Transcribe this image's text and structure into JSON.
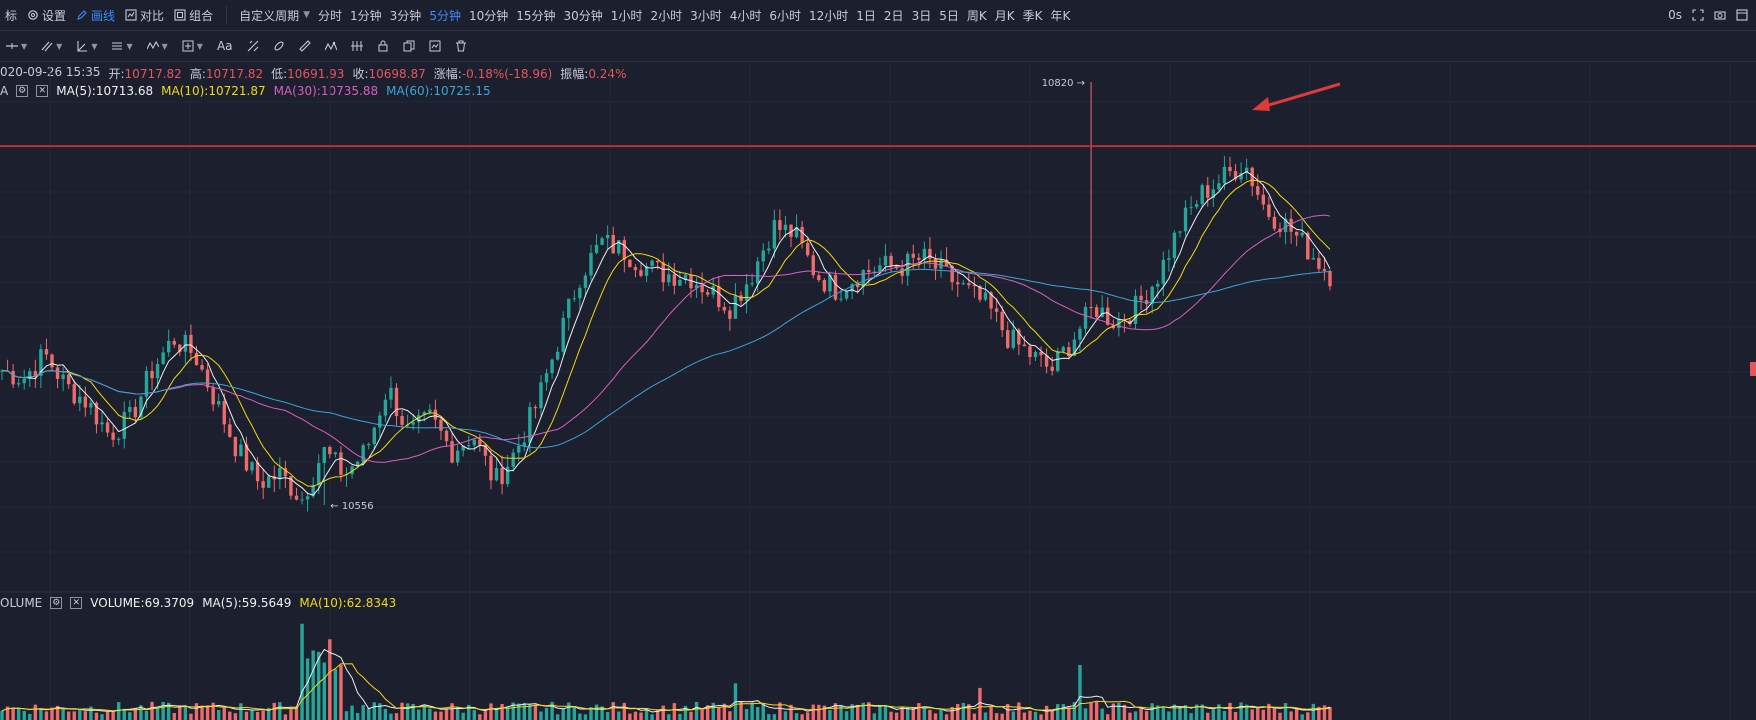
{
  "toolbar": {
    "items": [
      {
        "label": "标",
        "icon": "indicator-icon"
      },
      {
        "label": "设置",
        "icon": "gear-icon"
      },
      {
        "label": "画线",
        "icon": "pen-icon",
        "active": true
      },
      {
        "label": "对比",
        "icon": "compare-icon"
      },
      {
        "label": "组合",
        "icon": "layout-icon"
      }
    ],
    "custom_period": "自定义周期",
    "periods": [
      "分时",
      "1分钟",
      "3分钟",
      "5分钟",
      "10分钟",
      "15分钟",
      "30分钟",
      "1小时",
      "2小时",
      "3小时",
      "4小时",
      "6小时",
      "12小时",
      "1日",
      "2日",
      "3日",
      "5日",
      "周K",
      "月K",
      "季K",
      "年K"
    ],
    "active_period": "5分钟",
    "countdown": "0s"
  },
  "drawing_tools": [
    "line-tool-icon",
    "parallel-tool-icon",
    "angle-tool-icon",
    "hlines-tool-icon",
    "wave-tool-icon",
    "measure-tool-icon",
    "text-tool-icon",
    "fib-tool-icon",
    "brush-tool-icon",
    "ruler-tool-icon",
    "pattern-tool-icon",
    "lock-icon",
    "copy-icon",
    "screenshot-icon",
    "delete-icon"
  ],
  "text_tool_label": "Aa",
  "ohlc": {
    "datetime": "020-09-26 15:35",
    "open_label": "开:",
    "open": "10717.82",
    "high_label": "高:",
    "high": "10717.82",
    "low_label": "低:",
    "low": "10691.93",
    "close_label": "收:",
    "close": "10698.87",
    "change_label": "涨幅:",
    "change": "-0.18%(-18.96)",
    "amplitude_label": "振幅:",
    "amplitude": "0.24%"
  },
  "ma_indicator": {
    "name": "A",
    "ma5_label": "MA(5):",
    "ma5": "10713.68",
    "ma10_label": "MA(10):",
    "ma10": "10721.87",
    "ma30_label": "MA(30):",
    "ma30": "10735.88",
    "ma60_label": "MA(60):",
    "ma60": "10725.15"
  },
  "volume_indicator": {
    "name": "OLUME",
    "volume_label": "VOLUME:",
    "volume": "69.3709",
    "ma5_label": "MA(5):",
    "ma5": "59.5649",
    "ma10_label": "MA(10):",
    "ma10": "62.8343"
  },
  "annotations": {
    "high_marker": "10820 →",
    "low_marker": "← 10556"
  },
  "colors": {
    "background": "#1b1f2e",
    "up": "#26a69a",
    "down": "#ef6b6b",
    "ma5": "#f0f0f0",
    "ma10": "#f5d90a",
    "ma30": "#d95fc0",
    "ma60": "#3aa6d6",
    "red_line": "#d43030",
    "accent": "#3d8cff"
  },
  "chart_data": {
    "type": "candlestick",
    "title": "",
    "y_range": [
      10556,
      10820
    ],
    "horizontal_line": 10780,
    "price_path": [
      10640,
      10635,
      10650,
      10630,
      10620,
      10600,
      10610,
      10640,
      10660,
      10650,
      10620,
      10590,
      10570,
      10575,
      10560,
      10590,
      10575,
      10590,
      10630,
      10600,
      10610,
      10590,
      10600,
      10570,
      10590,
      10620,
      10660,
      10700,
      10720,
      10715,
      10705,
      10700,
      10700,
      10690,
      10680,
      10700,
      10730,
      10725,
      10700,
      10690,
      10700,
      10705,
      10705,
      10710,
      10700,
      10690,
      10680,
      10660,
      10650,
      10640,
      10660,
      10680,
      10670,
      10680,
      10700,
      10730,
      10750,
      10760,
      10770,
      10740,
      10730,
      10715,
      10700
    ],
    "volume_ma5_peak": 60,
    "volume_ma10_peak": 63
  }
}
